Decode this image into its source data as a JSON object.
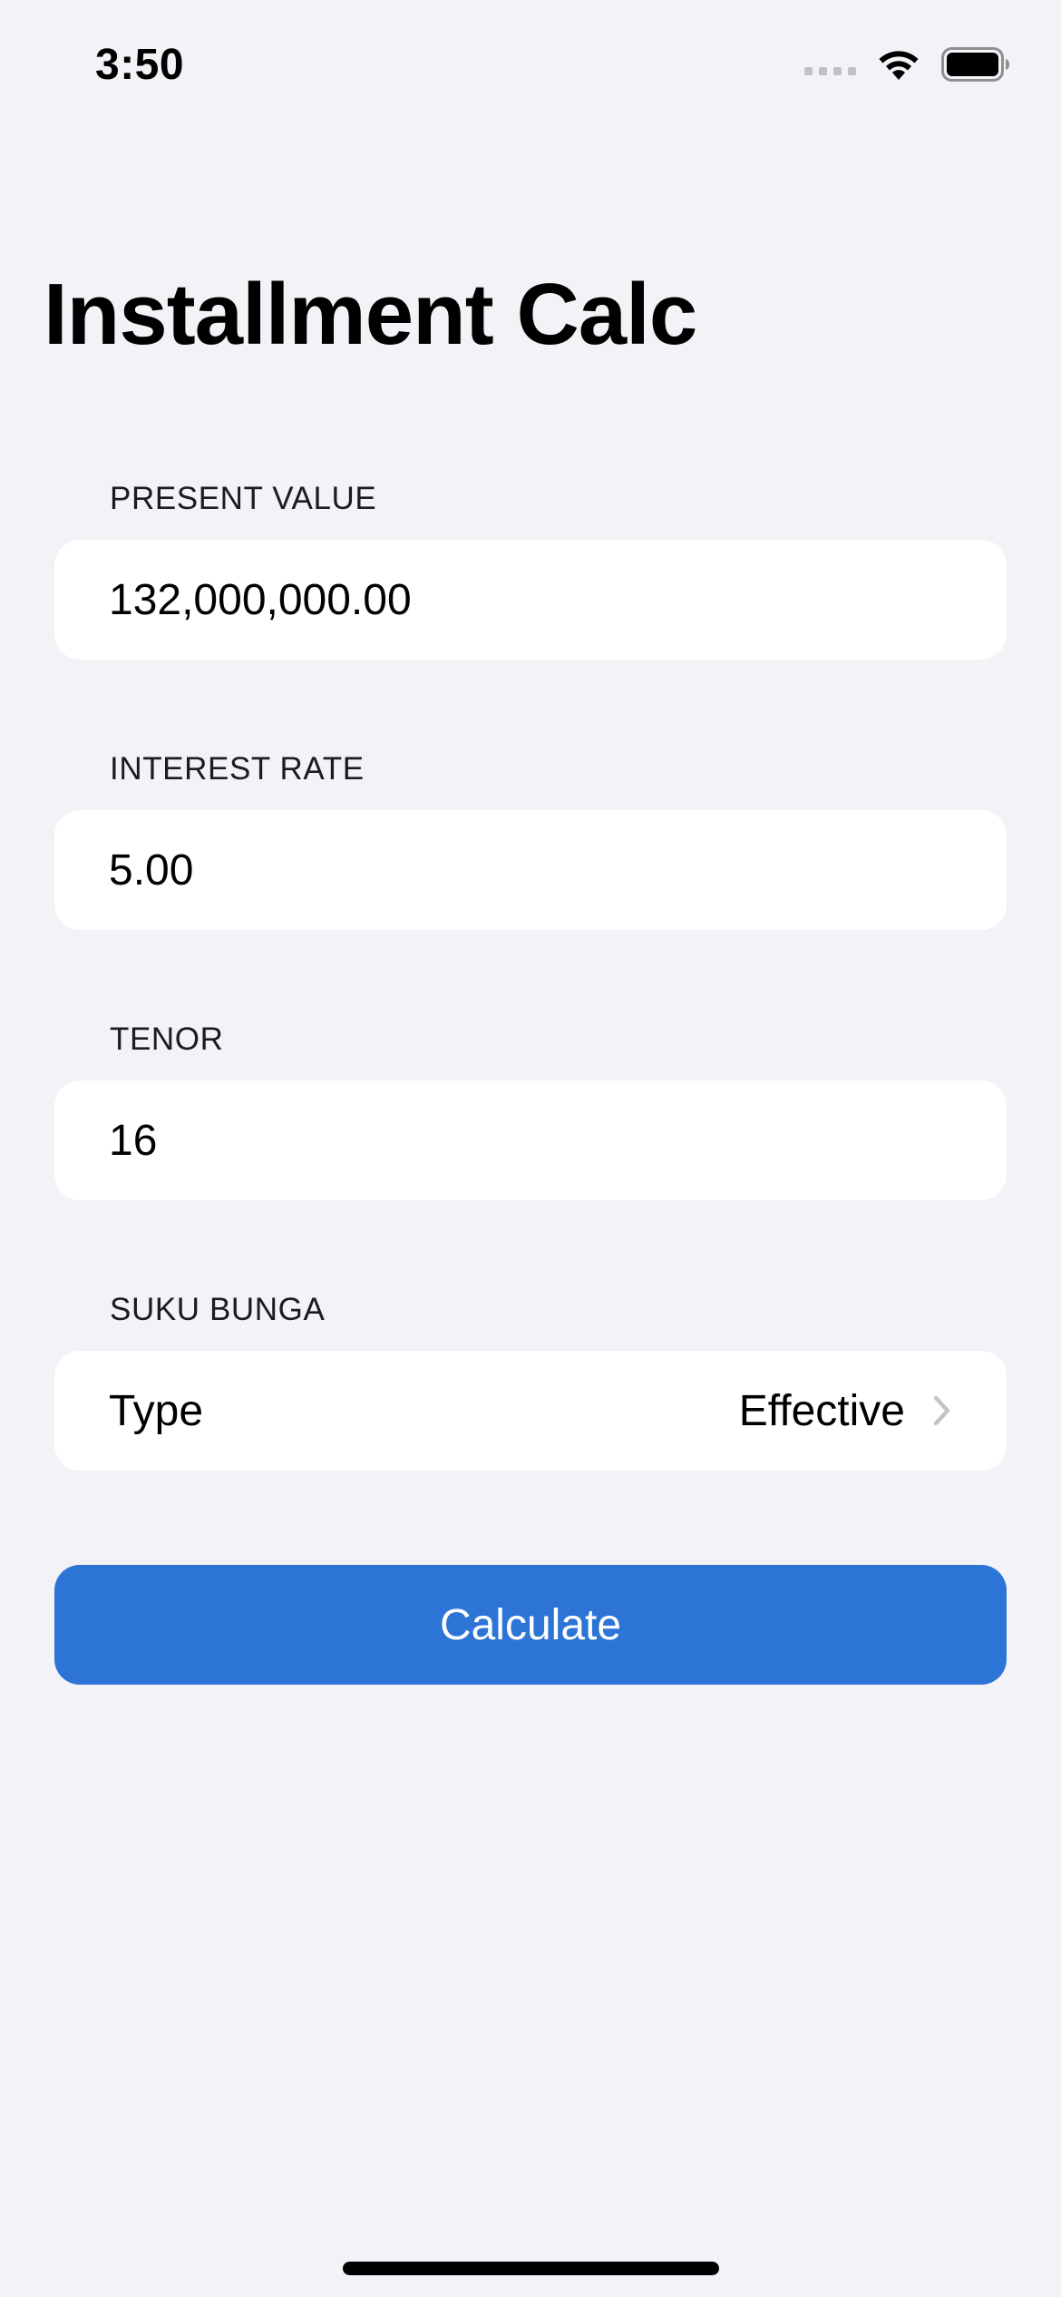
{
  "status_bar": {
    "time": "3:50",
    "icons": [
      "cellular-signal-icon",
      "wifi-icon",
      "battery-icon"
    ]
  },
  "page": {
    "title": "Installment Calc"
  },
  "form": {
    "present_value": {
      "header": "PRESENT VALUE",
      "value": "132,000,000.00"
    },
    "interest_rate": {
      "header": "INTEREST RATE",
      "value": "5.00"
    },
    "tenor": {
      "header": "TENOR",
      "value": "16"
    },
    "suku_bunga": {
      "header": "SUKU BUNGA",
      "label": "Type",
      "selected": "Effective"
    }
  },
  "actions": {
    "calculate_label": "Calculate"
  },
  "colors": {
    "background": "#f2f2f7",
    "card": "#ffffff",
    "accent": "#2c75d6"
  }
}
